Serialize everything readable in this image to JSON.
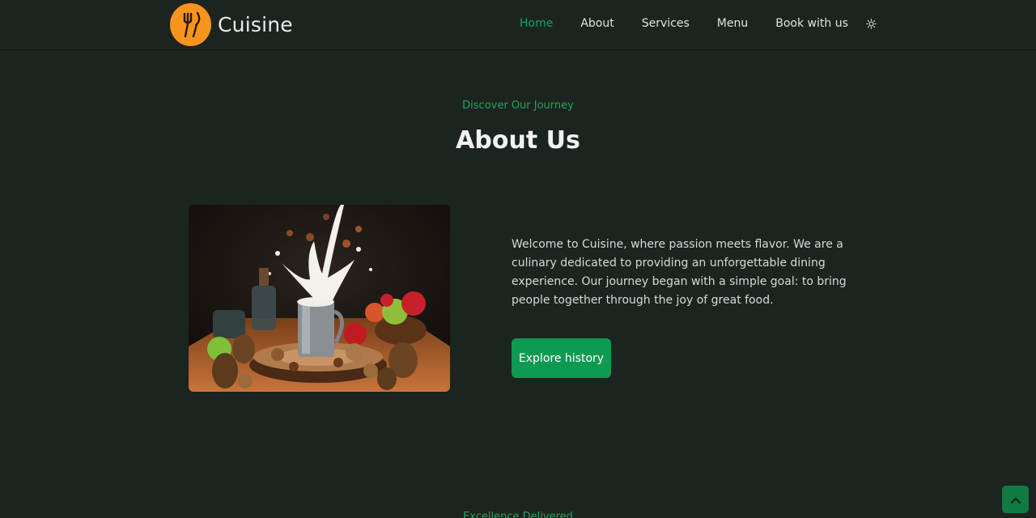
{
  "brand": {
    "name": "Cuisine",
    "logo_icon": "fork-knife-icon",
    "logo_color": "#f7941d"
  },
  "nav": {
    "items": [
      {
        "label": "Home",
        "active": true
      },
      {
        "label": "About",
        "active": false
      },
      {
        "label": "Services",
        "active": false
      },
      {
        "label": "Menu",
        "active": false
      },
      {
        "label": "Book with us",
        "active": false
      }
    ],
    "theme_toggle_icon": "sun-icon"
  },
  "about": {
    "eyebrow": "Discover Our Journey",
    "title": "About Us",
    "image_icon": "food-photo",
    "text": "Welcome to Cuisine, where passion meets flavor. We are a culinary dedicated to providing an unforgettable dining experience. Our journey began with a simple goal: to bring people together through the joy of great food.",
    "cta_label": "Explore history"
  },
  "next_section": {
    "eyebrow": "Excellence Delivered"
  },
  "scroll_top_icon": "chevron-up-icon",
  "colors": {
    "accent": "#16a35a",
    "button": "#0f9a52",
    "background": "#1c2420"
  }
}
